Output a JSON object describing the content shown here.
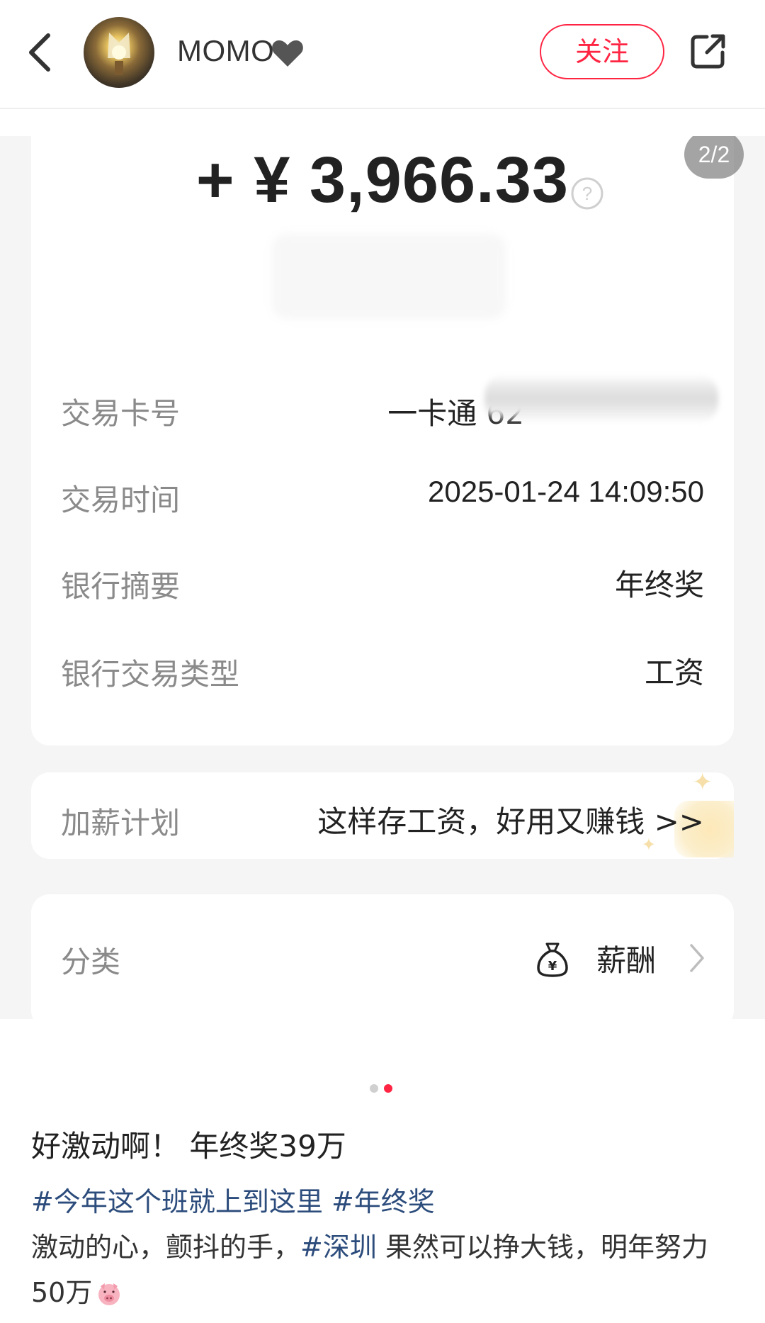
{
  "header": {
    "username": "MOMO",
    "follow_label": "关注"
  },
  "image": {
    "page_indicator": "2/2",
    "amount": "+ ¥ 3,966.33",
    "rows": [
      {
        "label": "交易卡号",
        "value": "一卡通 62"
      },
      {
        "label": "交易时间",
        "value": "2025-01-24 14:09:50"
      },
      {
        "label": "银行摘要",
        "value": "年终奖"
      },
      {
        "label": "银行交易类型",
        "value": "工资"
      }
    ],
    "plan": {
      "label": "加薪计划",
      "value": "这样存工资，好用又赚钱 >>"
    },
    "category": {
      "label": "分类",
      "value": "薪酬"
    }
  },
  "carousel": {
    "total": 2,
    "active": 2
  },
  "post": {
    "title": "好激动啊！ 年终奖39万",
    "tag1": "#今年这个班就上到这里",
    "tag2": "#年终奖",
    "body_part1": "激动的心，颤抖的手，",
    "tag3": "#深圳",
    "body_part2": " 果然可以挣大钱，明年努力50万"
  },
  "colors": {
    "accent": "#ff2442",
    "tag": "#2c4c7c",
    "label_gray": "#8a8a8a",
    "dot_inactive": "#d0d0d0",
    "dot_active": "#ff2442"
  },
  "icons": [
    "back-icon",
    "heart-icon",
    "share-icon",
    "help-icon",
    "bag-icon",
    "chevron-right-icon",
    "pig-emoji-icon"
  ]
}
